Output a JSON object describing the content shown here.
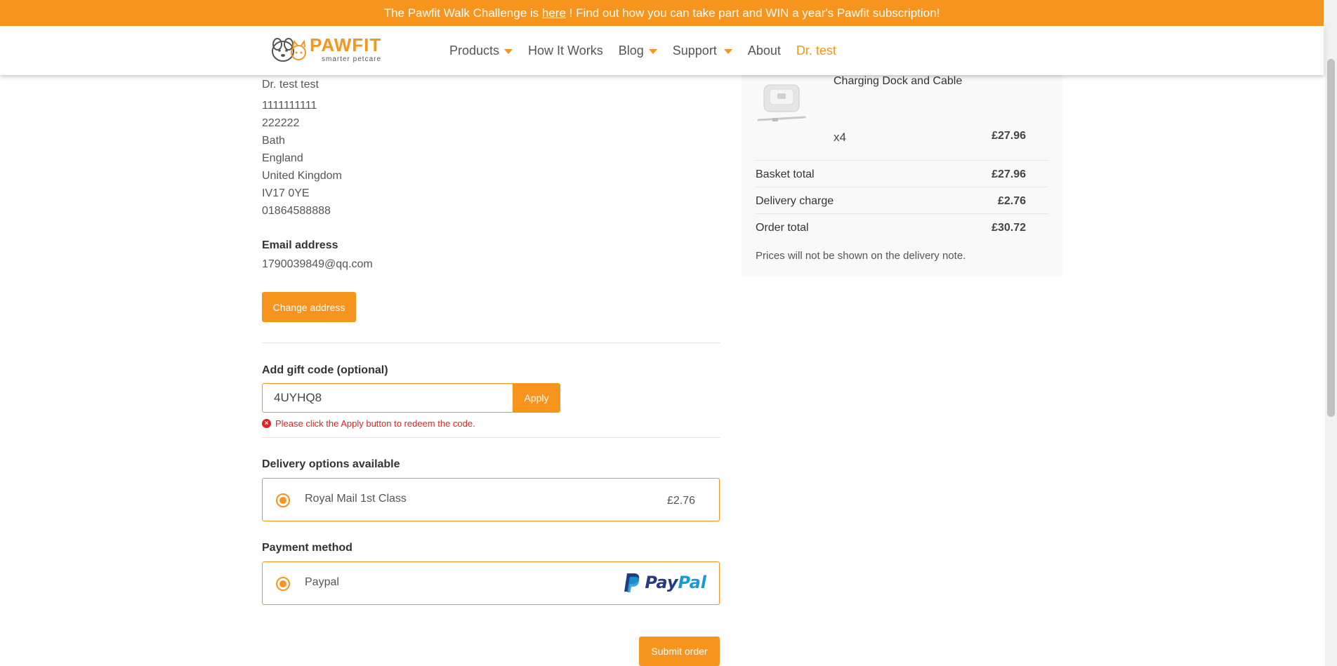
{
  "announcement": {
    "before": "The Pawfit Walk Challenge is ",
    "link": "here",
    "after": " ! Find out how you can take part and WIN a year's Pawfit subscription!"
  },
  "brand": {
    "name": "PAWFIT",
    "tagline": "smarter petcare",
    "accent": "#f7941d"
  },
  "nav": {
    "products": "Products",
    "how_it_works": "How It Works",
    "blog": "Blog",
    "support": "Support",
    "about": "About",
    "user": "Dr. test"
  },
  "address": {
    "name": "Dr. test test",
    "lines": [
      "1111111111",
      "222222",
      "Bath",
      "England",
      "United Kingdom",
      "IV17 0YE",
      "01864588888"
    ]
  },
  "email": {
    "label": "Email address",
    "value": "1790039849@qq.com"
  },
  "change_address_label": "Change address",
  "gift": {
    "label": "Add gift code (optional)",
    "value": "4UYHQ8",
    "apply_label": "Apply",
    "error": "Please click the Apply button to redeem the code."
  },
  "delivery": {
    "heading": "Delivery options available",
    "option": "Royal Mail 1st Class",
    "price": "£2.76"
  },
  "payment": {
    "heading": "Payment method",
    "option": "Paypal",
    "logo_part1": "Pay",
    "logo_part2": "Pal"
  },
  "submit_label": "Submit order",
  "summary": {
    "product_name": "Charging Dock and Cable",
    "qty": "x4",
    "product_price": "£27.96",
    "basket_total_label": "Basket total",
    "basket_total": "£27.96",
    "delivery_label": "Delivery charge",
    "delivery": "£2.76",
    "order_total_label": "Order total",
    "order_total": "£30.72",
    "note": "Prices will not be shown on the delivery note."
  }
}
